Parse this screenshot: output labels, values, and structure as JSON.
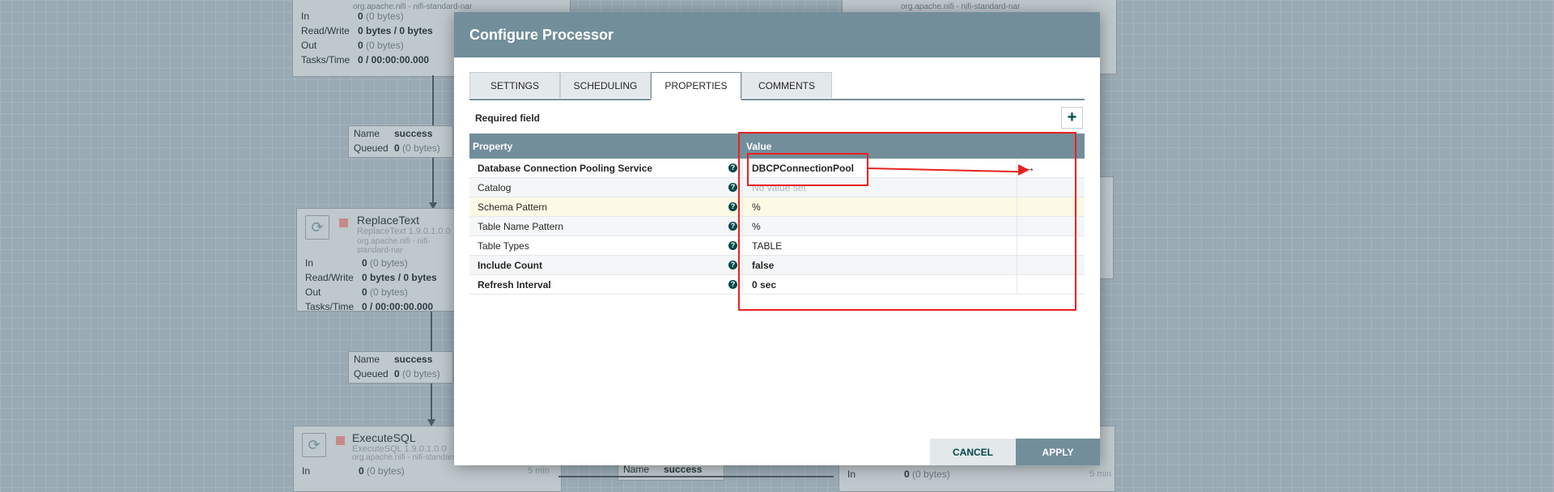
{
  "canvas": {
    "proc_top": {
      "bundle": "org.apache.nifi - nifi-standard-nar",
      "stats": [
        {
          "label": "In",
          "value": "0",
          "extra": "(0 bytes)"
        },
        {
          "label": "Read/Write",
          "value": "0 bytes / 0 bytes",
          "extra": ""
        },
        {
          "label": "Out",
          "value": "0",
          "extra": "(0 bytes)"
        },
        {
          "label": "Tasks/Time",
          "value": "0 / 00:00:00.000",
          "extra": ""
        }
      ]
    },
    "proc_right_top": {
      "bundle": "org.apache.nifi - nifi-standard-nar"
    },
    "conn1": {
      "name_label": "Name",
      "name_value": "success",
      "queued_label": "Queued",
      "queued_value": "0",
      "queued_extra": "(0 bytes)"
    },
    "proc_replace": {
      "title": "ReplaceText",
      "type": "ReplaceText 1.9.0.1.0.0",
      "bundle": "org.apache.nifi - nifi-standard-nar",
      "stats": [
        {
          "label": "In",
          "value": "0",
          "extra": "(0 bytes)"
        },
        {
          "label": "Read/Write",
          "value": "0 bytes / 0 bytes",
          "extra": ""
        },
        {
          "label": "Out",
          "value": "0",
          "extra": "(0 bytes)"
        },
        {
          "label": "Tasks/Time",
          "value": "0 / 00:00:00.000",
          "extra": ""
        }
      ]
    },
    "conn2": {
      "name_label": "Name",
      "name_value": "success",
      "queued_label": "Queued",
      "queued_value": "0",
      "queued_extra": "(0 bytes)"
    },
    "proc_execsql": {
      "title": "ExecuteSQL",
      "type": "ExecuteSQL 1.9.0.1.0.0",
      "bundle": "org.apache.nifi - nifi-standard",
      "in_label": "In",
      "in_value": "0",
      "in_extra": "(0 bytes)",
      "in_time": "5 min"
    },
    "conn3": {
      "name_label": "Name",
      "name_value": "success"
    },
    "proc_right_bottom": {
      "in_label": "In",
      "in_value": "0",
      "in_extra": "(0 bytes)",
      "in_time": "5 min"
    }
  },
  "dialog": {
    "title": "Configure Processor",
    "tabs": [
      "Settings",
      "Scheduling",
      "Properties",
      "Comments"
    ],
    "active_tab": "Properties",
    "required_field": "Required field",
    "add_icon": "plus-icon",
    "table": {
      "headers": {
        "property": "Property",
        "value": "Value"
      },
      "rows": [
        {
          "name": "Database Connection Pooling Service",
          "value": "DBCPConnectionPool",
          "required": true
        },
        {
          "name": "Catalog",
          "value": "No value set",
          "required": false
        },
        {
          "name": "Schema Pattern",
          "value": "%",
          "required": false
        },
        {
          "name": "Table Name Pattern",
          "value": "%",
          "required": false
        },
        {
          "name": "Table Types",
          "value": "TABLE",
          "required": false
        },
        {
          "name": "Include Count",
          "value": "false",
          "required": true
        },
        {
          "name": "Refresh Interval",
          "value": "0 sec",
          "required": true
        }
      ]
    },
    "help_glyph": "?",
    "goto_glyph": "→",
    "buttons": {
      "cancel": "Cancel",
      "apply": "Apply"
    }
  },
  "colors": {
    "header": "#728e9b",
    "annotation": "#e8221e",
    "accent": "#004849"
  }
}
